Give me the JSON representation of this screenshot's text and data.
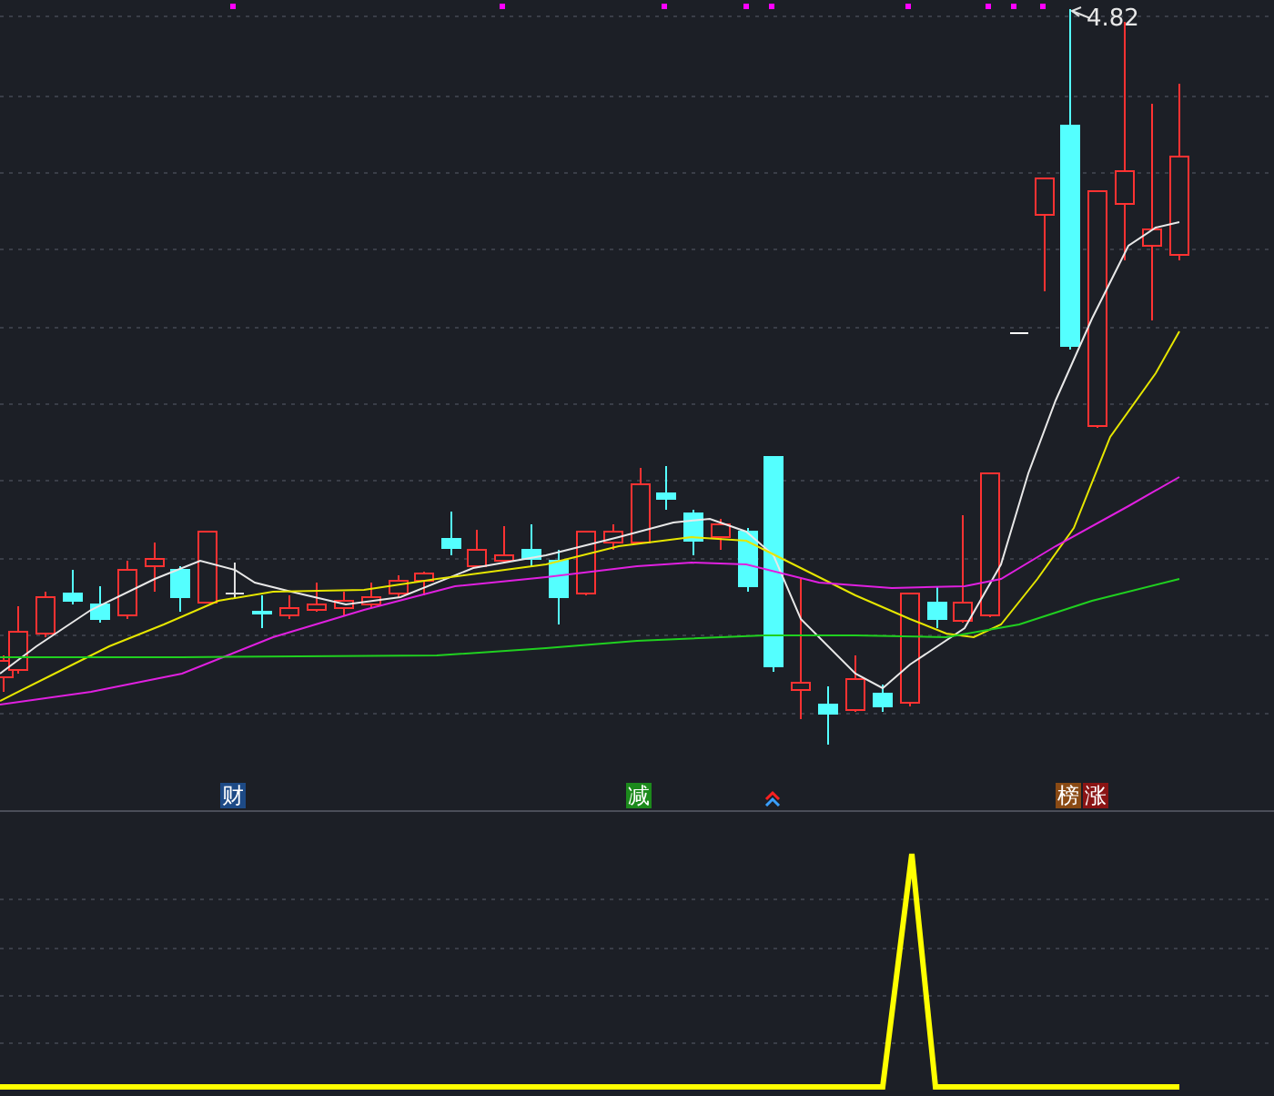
{
  "price_label": "4.82",
  "event_tags": [
    {
      "text": "财",
      "color": "#1d4a86"
    },
    {
      "text": "减",
      "color": "#1c8a1c"
    },
    {
      "text": "榜",
      "color": "#8a4a14"
    },
    {
      "text": "涨",
      "color": "#8a1414"
    }
  ]
}
